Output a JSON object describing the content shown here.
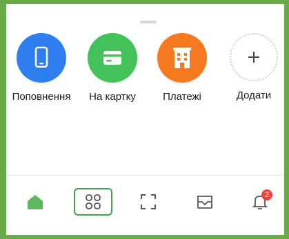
{
  "quick_actions": [
    {
      "label": "Поповнення",
      "icon": "phone-icon",
      "color": "#2f7ef0"
    },
    {
      "label": "На картку",
      "icon": "card-icon",
      "color": "#45c15a"
    },
    {
      "label": "Платежі",
      "icon": "building-icon",
      "color": "#f57a1f"
    },
    {
      "label": "Додати",
      "icon": "plus-icon",
      "color": "#ffffff"
    }
  ],
  "tabbar": {
    "items": [
      {
        "name": "home",
        "icon": "home-icon",
        "active_color": "#5cb85c"
      },
      {
        "name": "services",
        "icon": "grid-icon"
      },
      {
        "name": "scan",
        "icon": "scan-icon"
      },
      {
        "name": "inbox",
        "icon": "inbox-icon"
      },
      {
        "name": "notifications",
        "icon": "bell-icon",
        "badge": "2"
      }
    ]
  },
  "colors": {
    "frame": "#6aaa48",
    "highlight": "#3ea44e",
    "badge": "#f04438",
    "icon_gray": "#555555"
  }
}
